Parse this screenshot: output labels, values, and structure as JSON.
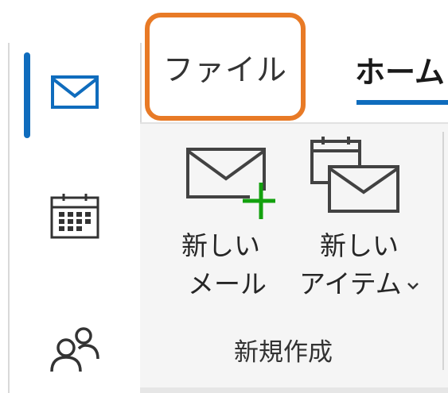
{
  "nav": {
    "items": [
      {
        "id": "mail",
        "icon": "mail-icon",
        "selected": true
      },
      {
        "id": "calendar",
        "icon": "calendar-icon",
        "selected": false
      },
      {
        "id": "people",
        "icon": "people-icon",
        "selected": false
      }
    ]
  },
  "tabs": {
    "file": "ファイル",
    "home": "ホーム"
  },
  "ribbon": {
    "group_new": {
      "label": "新規作成",
      "new_mail": {
        "line1": "新しい",
        "line2": "メール",
        "icon": "new-mail-icon"
      },
      "new_item": {
        "line1": "新しい",
        "line2": "アイテム",
        "icon": "new-items-icon",
        "dropdown": "chevron-down-icon"
      }
    }
  },
  "colors": {
    "accent": "#0f6cbd",
    "highlight": "#e87a26",
    "add_plus": "#13a10e"
  }
}
